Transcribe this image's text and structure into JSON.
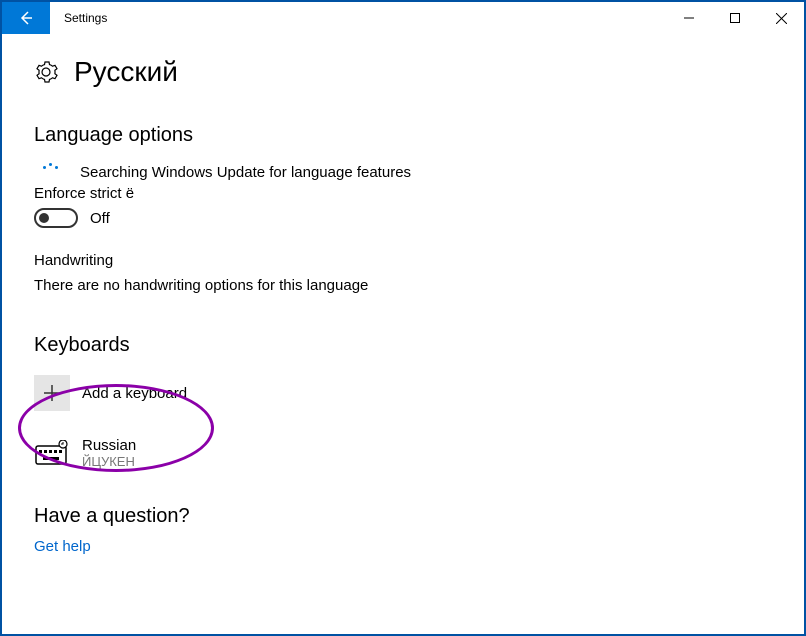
{
  "titlebar": {
    "title": "Settings"
  },
  "page": {
    "title": "Русский"
  },
  "languageOptions": {
    "heading": "Language options",
    "updateStatus": "Searching Windows Update for language features",
    "enforceLabel": "Enforce strict ё",
    "toggleState": "Off",
    "handwritingLabel": "Handwriting",
    "handwritingText": "There are no handwriting options for this language"
  },
  "keyboards": {
    "heading": "Keyboards",
    "addLabel": "Add a keyboard",
    "items": [
      {
        "name": "Russian",
        "subtitle": "ЙЦУКЕН"
      }
    ]
  },
  "help": {
    "heading": "Have a question?",
    "link": "Get help"
  }
}
